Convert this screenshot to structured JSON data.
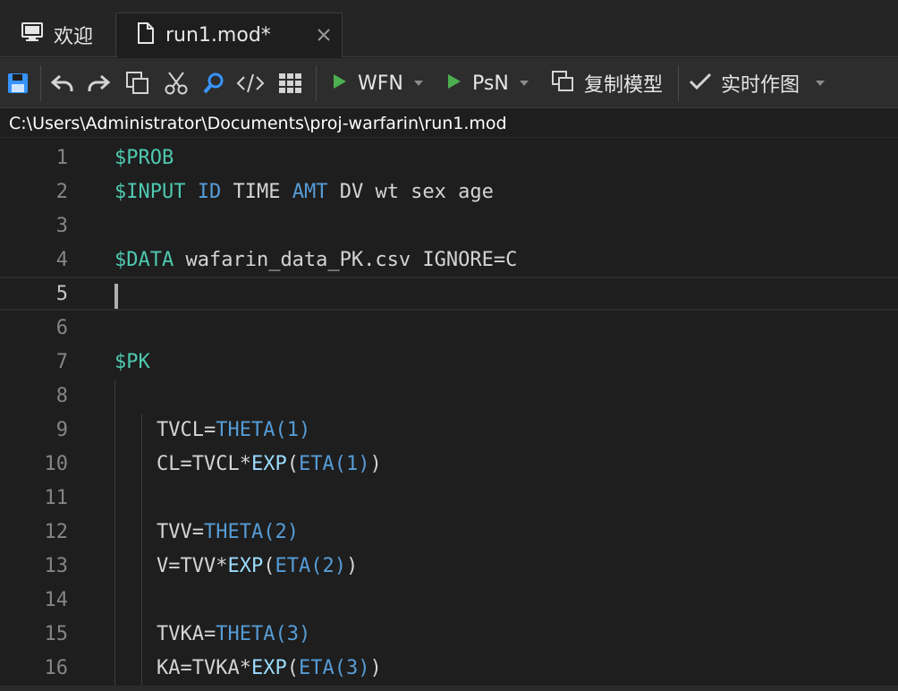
{
  "tabs": [
    {
      "label": "欢迎",
      "icon": "monitor-icon"
    },
    {
      "label": "run1.mod*",
      "icon": "file-icon",
      "close_icon": "close-icon"
    }
  ],
  "toolbar": {
    "wfn_label": "WFN",
    "psn_label": "PsN",
    "copy_model_label": "复制模型",
    "live_plot_label": "实时作图",
    "icons": [
      "save-icon",
      "undo-icon",
      "redo-icon",
      "copy-icon",
      "cut-icon",
      "search-icon",
      "code-icon",
      "grid-icon",
      "play-icon",
      "check-icon"
    ]
  },
  "path": "C:\\Users\\Administrator\\Documents\\proj-warfarin\\run1.mod",
  "editor": {
    "current_line": 5,
    "lines": [
      {
        "n": "1",
        "tokens": [
          [
            "$PROB",
            "kw"
          ]
        ]
      },
      {
        "n": "2",
        "tokens": [
          [
            "$INPUT",
            "kw"
          ],
          [
            " ",
            "txt"
          ],
          [
            "ID",
            "fn"
          ],
          [
            " TIME ",
            "txt"
          ],
          [
            "AMT",
            "fn"
          ],
          [
            " DV wt sex age",
            "txt"
          ]
        ]
      },
      {
        "n": "3",
        "tokens": []
      },
      {
        "n": "4",
        "tokens": [
          [
            "$DATA",
            "kw"
          ],
          [
            " wafarin_data_PK.csv IGNORE=C",
            "txt"
          ]
        ]
      },
      {
        "n": "5",
        "tokens": []
      },
      {
        "n": "6",
        "tokens": []
      },
      {
        "n": "7",
        "tokens": [
          [
            "$PK",
            "kw"
          ]
        ]
      },
      {
        "n": "8",
        "tokens": []
      },
      {
        "n": "9",
        "tokens": [
          [
            "TVCL=",
            "txt"
          ],
          [
            "THETA(1)",
            "fn"
          ]
        ],
        "indent": true
      },
      {
        "n": "10",
        "tokens": [
          [
            "CL=TVCL*",
            "txt"
          ],
          [
            "EXP",
            "mth"
          ],
          [
            "(",
            "txt"
          ],
          [
            "ETA(1)",
            "fn"
          ],
          [
            ")",
            "txt"
          ]
        ],
        "indent": true
      },
      {
        "n": "11",
        "tokens": []
      },
      {
        "n": "12",
        "tokens": [
          [
            "TVV=",
            "txt"
          ],
          [
            "THETA(2)",
            "fn"
          ]
        ],
        "indent": true
      },
      {
        "n": "13",
        "tokens": [
          [
            "V=TVV*",
            "txt"
          ],
          [
            "EXP",
            "mth"
          ],
          [
            "(",
            "txt"
          ],
          [
            "ETA(2)",
            "fn"
          ],
          [
            ")",
            "txt"
          ]
        ],
        "indent": true
      },
      {
        "n": "14",
        "tokens": []
      },
      {
        "n": "15",
        "tokens": [
          [
            "TVKA=",
            "txt"
          ],
          [
            "THETA(3)",
            "fn"
          ]
        ],
        "indent": true
      },
      {
        "n": "16",
        "tokens": [
          [
            "KA=TVKA*",
            "txt"
          ],
          [
            "EXP",
            "mth"
          ],
          [
            "(",
            "txt"
          ],
          [
            "ETA(3)",
            "fn"
          ],
          [
            ")",
            "txt"
          ]
        ],
        "indent": true
      }
    ]
  }
}
